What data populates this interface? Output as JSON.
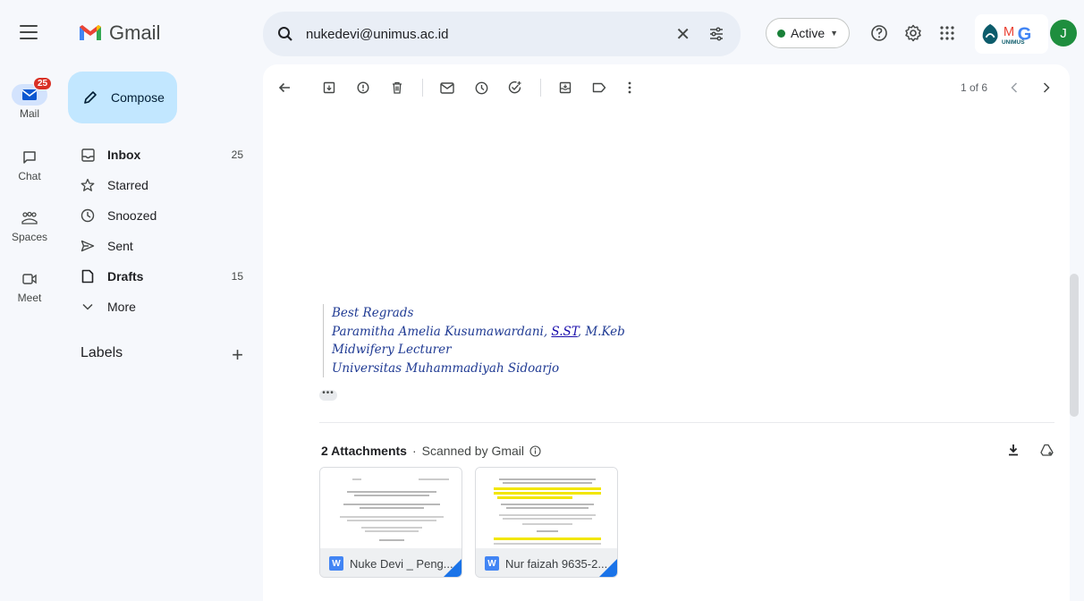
{
  "app": {
    "name": "Gmail"
  },
  "rail": {
    "mail": {
      "label": "Mail",
      "badge": "25"
    },
    "chat": {
      "label": "Chat"
    },
    "spaces": {
      "label": "Spaces"
    },
    "meet": {
      "label": "Meet"
    }
  },
  "compose": {
    "label": "Compose"
  },
  "nav": [
    {
      "label": "Inbox",
      "count": "25",
      "bold": true,
      "icon": "inbox-icon"
    },
    {
      "label": "Starred",
      "count": "",
      "bold": false,
      "icon": "star-icon"
    },
    {
      "label": "Snoozed",
      "count": "",
      "bold": false,
      "icon": "clock-icon"
    },
    {
      "label": "Sent",
      "count": "",
      "bold": false,
      "icon": "send-icon"
    },
    {
      "label": "Drafts",
      "count": "15",
      "bold": true,
      "icon": "draft-icon"
    },
    {
      "label": "More",
      "count": "",
      "bold": false,
      "icon": "chevron-down-icon"
    }
  ],
  "labels": {
    "title": "Labels",
    "add": "+"
  },
  "search": {
    "value": "nukedevi@unimus.ac.id"
  },
  "status": {
    "label": "Active"
  },
  "org_logo": {
    "text": "MG",
    "sub": "UNIMUS"
  },
  "avatar": {
    "initial": "J"
  },
  "pager": {
    "text": "1 of 6"
  },
  "message": {
    "signature": [
      "Best Regrads",
      "Paramitha Amelia Kusumawardani, ",
      "S.ST",
      ", M.Keb",
      "Midwifery Lecturer",
      "Universitas Muhammadiyah Sidoarjo"
    ],
    "trimmed": "•••"
  },
  "attachments": {
    "header": "2 Attachments",
    "scanned": "Scanned by Gmail",
    "files": [
      {
        "name": "Nuke Devi _ Peng...",
        "type": "W"
      },
      {
        "name": "Nur faizah 9635-2...",
        "type": "W"
      }
    ]
  },
  "colors": {
    "compose_bg": "#c2e7ff",
    "accent": "#1a73e8",
    "badge": "#d93025",
    "active_dot": "#188038"
  }
}
